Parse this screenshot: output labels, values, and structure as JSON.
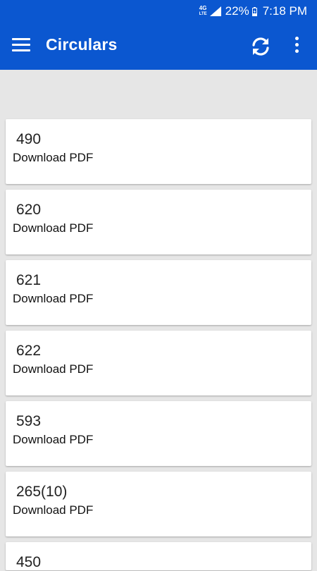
{
  "status_bar": {
    "network": "4G",
    "network_sub": "LTE",
    "battery_percent": "22%",
    "time": "7:18 PM"
  },
  "app_bar": {
    "title": "Circulars",
    "menu_icon": "hamburger-menu-icon",
    "refresh_icon": "refresh-icon",
    "overflow_icon": "more-vert-icon"
  },
  "circulars": [
    {
      "number": "490",
      "action": "Download PDF"
    },
    {
      "number": "620",
      "action": "Download PDF"
    },
    {
      "number": "621",
      "action": "Download PDF"
    },
    {
      "number": "622",
      "action": "Download PDF"
    },
    {
      "number": "593",
      "action": "Download PDF"
    },
    {
      "number": "265(10)",
      "action": "Download PDF"
    },
    {
      "number": "450",
      "action": ""
    }
  ],
  "colors": {
    "app_bar": "#0b57d0",
    "background": "#e6e6e6",
    "card": "#ffffff"
  }
}
